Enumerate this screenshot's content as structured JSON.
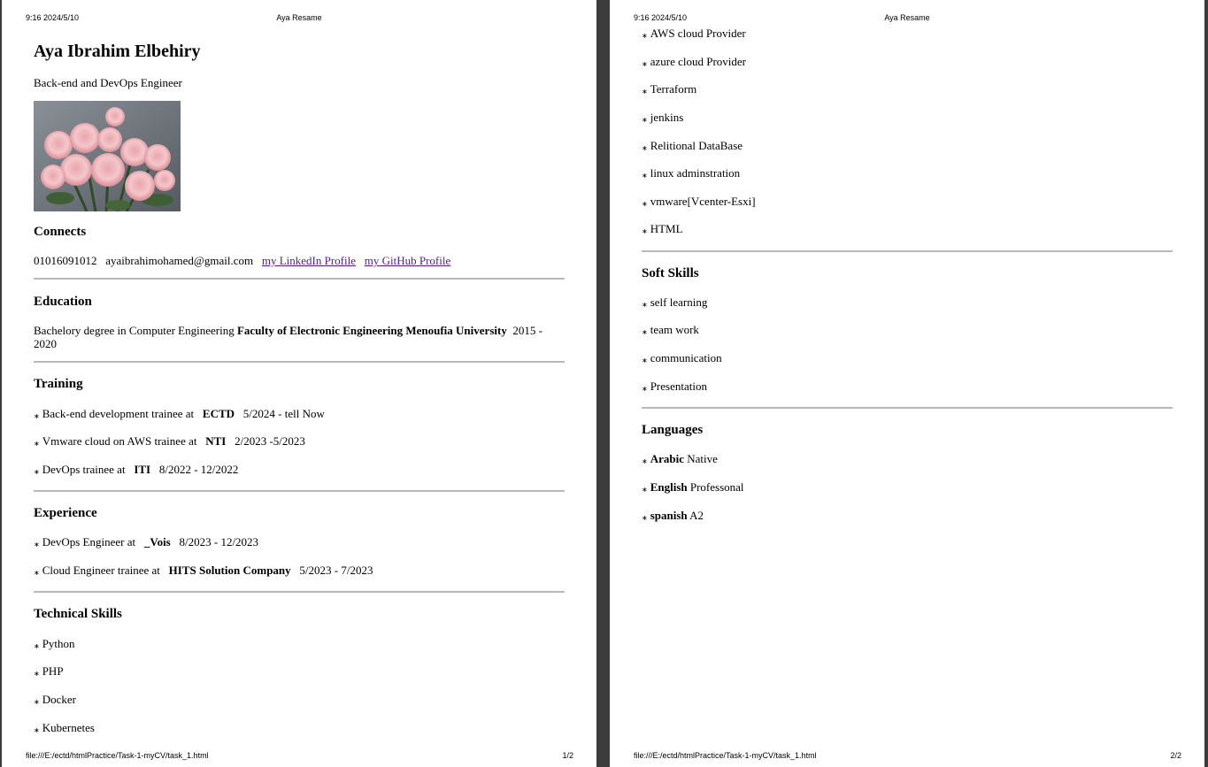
{
  "print_header": {
    "datetime": "9:16 2024/5/10",
    "title": "Aya Resame"
  },
  "print_footer": {
    "url": "file:///E:/ectd/htmlPractice/Task-1-myCV/task_1.html",
    "page1": "1/2",
    "page2": "2/2"
  },
  "profile": {
    "name": "Aya Ibrahim Elbehiry",
    "role": "Back-end and DevOps Engineer"
  },
  "connects": {
    "heading": "Connects",
    "phone": "01016091012",
    "email": "ayaibrahimohamed@gmail.com",
    "linkedin": "my LinkedIn Profile",
    "github": "my GitHub Profile"
  },
  "education": {
    "heading": "Education",
    "degree": "Bachelory degree in Computer Engineering",
    "school": "Faculty of Electronic Engineering Menoufia University",
    "years_a": "2015 -",
    "years_b": "2020"
  },
  "training": {
    "heading": "Training",
    "items": [
      {
        "text": "Back-end development trainee at",
        "org": "ECTD",
        "dates": "5/2024 - tell Now"
      },
      {
        "text": "Vmware cloud on AWS trainee at",
        "org": "NTI",
        "dates": "2/2023 -5/2023"
      },
      {
        "text": "DevOps trainee at",
        "org": "ITI",
        "dates": "8/2022 - 12/2022"
      }
    ]
  },
  "experience": {
    "heading": "Experience",
    "items": [
      {
        "text": "DevOps Engineer at",
        "org": "_Vois",
        "dates": "8/2023 - 12/2023"
      },
      {
        "text": "Cloud Engineer trainee at",
        "org": "HITS Solution Company",
        "dates": "5/2023 - 7/2023"
      }
    ]
  },
  "technical_skills": {
    "heading": "Technical Skills",
    "items": [
      "Python",
      "PHP",
      "Docker",
      "Kubernetes",
      "AWS cloud Provider",
      "azure cloud Provider",
      "Terraform",
      "jenkins",
      "Relitional DataBase",
      "linux adminstration",
      "vmware[Vcenter-Esxi]",
      "HTML"
    ]
  },
  "soft_skills": {
    "heading": "Soft Skills",
    "items": [
      "self learning",
      "team work",
      "communication",
      "Presentation"
    ]
  },
  "languages": {
    "heading": "Languages",
    "items": [
      {
        "lang": "Arabic",
        "level": "Native"
      },
      {
        "lang": "English",
        "level": "Professonal"
      },
      {
        "lang": "spanish",
        "level": "A2"
      }
    ]
  }
}
